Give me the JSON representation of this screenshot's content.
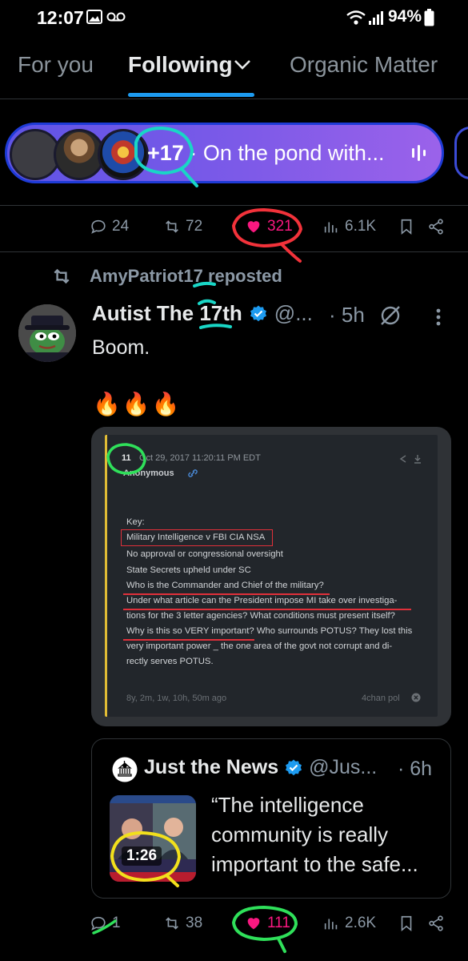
{
  "status_bar": {
    "time": "12:07",
    "battery": "94%",
    "icons": [
      "image-icon",
      "voicemail-icon",
      "wifi-icon",
      "signal-icon",
      "battery-icon"
    ]
  },
  "tabs": [
    {
      "label": "For you",
      "active": false
    },
    {
      "label": "Following",
      "active": true
    },
    {
      "label": "Organic Matter",
      "active": false
    }
  ],
  "space_pill": {
    "count": "+17",
    "separator": " · ",
    "title": "On the pond with...",
    "accent": "#7d5ae8"
  },
  "prev_post_actions": {
    "replies": "24",
    "reposts": "72",
    "likes": "321",
    "views": "6.1K"
  },
  "post": {
    "reposted_by": "AmyPatriot17 reposted",
    "author": "Autist The 17th",
    "handle": "@...",
    "time": "· 5h",
    "text": "Boom.",
    "emoji": "🔥🔥🔥",
    "image": {
      "post_number": "11",
      "date_line": "Oct 29, 2017 11:20:11 PM EDT",
      "author": "Anonymous",
      "lines": [
        "Key:",
        "Military Intelligence v FBI CIA NSA",
        "No approval or congressional oversight",
        "State Secrets upheld under SC",
        "Who is the Commander and Chief of the military?",
        "Under what article can the President impose MI take over investiga-",
        "tions for the 3 letter agencies? What conditions must present itself?",
        "Why is this so VERY important? Who surrounds POTUS? They lost this",
        "very important power _ the one area of the govt not corrupt and di-",
        "rectly serves POTUS."
      ],
      "footer_left": "8y, 2m, 1w, 10h, 50m ago",
      "footer_right": "4chan pol"
    },
    "quote": {
      "author": "Just the News",
      "handle": "@Jus...",
      "time": "· 6h",
      "duration": "1:26",
      "text": "“The intelligence community is really important to the safe..."
    },
    "actions": {
      "replies": "1",
      "reposts": "38",
      "likes": "111",
      "views": "2.6K"
    }
  },
  "colors": {
    "accent_blue": "#1d9bf0",
    "like_pink": "#f91880",
    "muted": "#8b98a5",
    "verified": "#1d9bf0"
  }
}
